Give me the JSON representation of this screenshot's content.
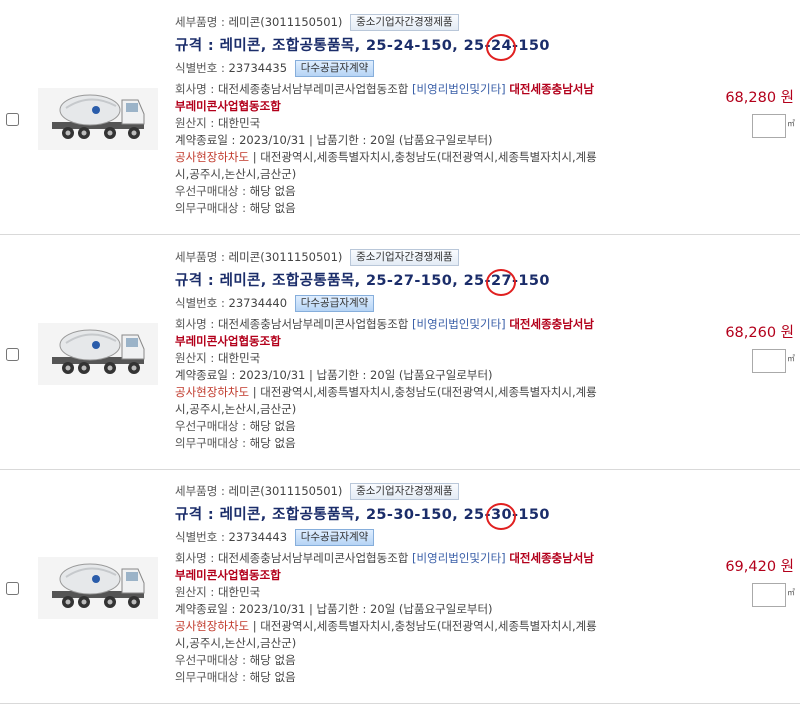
{
  "items": [
    {
      "detail_label": "세부품명 : ",
      "detail_value": "레미콘(3011150501)",
      "badge_sme": "중소기업자간경쟁제품",
      "spec_prefix": "규격 : 레미콘, 조합공통품목, 25-24-150, 25-",
      "spec_circled": "24",
      "spec_suffix": "-150",
      "id_label": "식별번호 : ",
      "id_value": "23734435",
      "badge_contract": "다수공급자계약",
      "company_label": "회사명 : ",
      "company_value": "대전세종충남서남부레미콘사업협동조합",
      "company_cat": "[비영리법인및기타]",
      "company_red_1": "대전세종충남서남",
      "company_red_2": "부레미콘사업협동조합",
      "origin_label": "원산지 : ",
      "origin_value": "대한민국",
      "contract_text": "계약종료일 : 2023/10/31 | 납품기한 : 20일 (납품요구일로부터)",
      "delivery_label": "공사현장하차도",
      "delivery_text_1": " | 대전광역시,세종특별자치시,충청남도(대전광역시,세종특별자치시,계룡",
      "delivery_text_2": "시,공주시,논산시,금산군)",
      "priority_label": "우선구매대상 : ",
      "priority_value": "해당 없음",
      "mandatory_label": "의무구매대상 : ",
      "mandatory_value": "해당 없음",
      "price": "68,280 원",
      "unit": "㎥"
    },
    {
      "detail_label": "세부품명 : ",
      "detail_value": "레미콘(3011150501)",
      "badge_sme": "중소기업자간경쟁제품",
      "spec_prefix": "규격 : 레미콘, 조합공통품목, 25-27-150, 25-",
      "spec_circled": "27",
      "spec_suffix": "-150",
      "id_label": "식별번호 : ",
      "id_value": "23734440",
      "badge_contract": "다수공급자계약",
      "company_label": "회사명 : ",
      "company_value": "대전세종충남서남부레미콘사업협동조합",
      "company_cat": "[비영리법인및기타]",
      "company_red_1": "대전세종충남서남",
      "company_red_2": "부레미콘사업협동조합",
      "origin_label": "원산지 : ",
      "origin_value": "대한민국",
      "contract_text": "계약종료일 : 2023/10/31 | 납품기한 : 20일 (납품요구일로부터)",
      "delivery_label": "공사현장하차도",
      "delivery_text_1": " | 대전광역시,세종특별자치시,충청남도(대전광역시,세종특별자치시,계룡",
      "delivery_text_2": "시,공주시,논산시,금산군)",
      "priority_label": "우선구매대상 : ",
      "priority_value": "해당 없음",
      "mandatory_label": "의무구매대상 : ",
      "mandatory_value": "해당 없음",
      "price": "68,260 원",
      "unit": "㎥"
    },
    {
      "detail_label": "세부품명 : ",
      "detail_value": "레미콘(3011150501)",
      "badge_sme": "중소기업자간경쟁제품",
      "spec_prefix": "규격 : 레미콘, 조합공통품목, 25-30-150, 25-",
      "spec_circled": "30",
      "spec_suffix": "-150",
      "id_label": "식별번호 : ",
      "id_value": "23734443",
      "badge_contract": "다수공급자계약",
      "company_label": "회사명 : ",
      "company_value": "대전세종충남서남부레미콘사업협동조합",
      "company_cat": "[비영리법인및기타]",
      "company_red_1": "대전세종충남서남",
      "company_red_2": "부레미콘사업협동조합",
      "origin_label": "원산지 : ",
      "origin_value": "대한민국",
      "contract_text": "계약종료일 : 2023/10/31 | 납품기한 : 20일 (납품요구일로부터)",
      "delivery_label": "공사현장하차도",
      "delivery_text_1": " | 대전광역시,세종특별자치시,충청남도(대전광역시,세종특별자치시,계룡",
      "delivery_text_2": "시,공주시,논산시,금산군)",
      "priority_label": "우선구매대상 : ",
      "priority_value": "해당 없음",
      "mandatory_label": "의무구매대상 : ",
      "mandatory_value": "해당 없음",
      "price": "69,420 원",
      "unit": "㎥"
    }
  ],
  "colors": {
    "title": "#1b2d6a",
    "price": "#b3001b",
    "circle": "#e02020"
  },
  "icons": {
    "thumbnail": "concrete-mixer-truck-icon"
  }
}
